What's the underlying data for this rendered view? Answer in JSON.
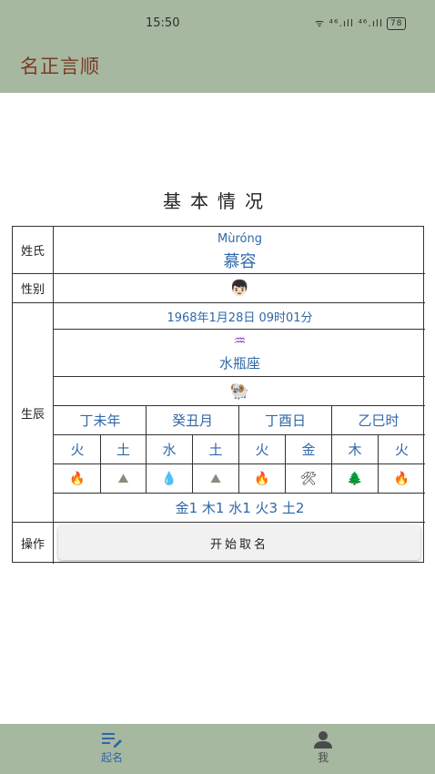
{
  "status": {
    "time": "15:50",
    "signal": "ᯤ ⁴⁶.ıll ⁴⁶.ıll",
    "battery": "78"
  },
  "app": {
    "title": "名正言顺"
  },
  "section": {
    "title": "基本情况"
  },
  "table": {
    "labels": {
      "surname": "姓氏",
      "gender": "性别",
      "birth": "生辰",
      "action": "操作"
    },
    "pinyin": "Mùróng",
    "surname": "慕容",
    "gender_icon": "👦🏻",
    "datetime": "1968年1月28日  09时01分",
    "zodiac_symbol": "♒",
    "zodiac_name": "水瓶座",
    "animal_icon": "🐏",
    "pillars": [
      "丁未年",
      "癸丑月",
      "丁酉日",
      "乙巳时"
    ],
    "elements": [
      "火",
      "土",
      "水",
      "土",
      "火",
      "金",
      "木",
      "火"
    ],
    "element_icons": [
      "🔥",
      "⛰",
      "💧",
      "⛰",
      "🔥",
      "🛠",
      "🌲",
      "🔥"
    ],
    "summary": "金1 木1 水1 火3 土2",
    "start_button": "开始取名"
  },
  "nav": {
    "items": [
      {
        "label": "起名",
        "icon": "edit-list-icon",
        "active": true
      },
      {
        "label": "我",
        "icon": "person-icon",
        "active": false
      }
    ]
  },
  "colors": {
    "header": "#a7b8a0",
    "title": "#7b3a25",
    "accent": "#2f67a8"
  }
}
